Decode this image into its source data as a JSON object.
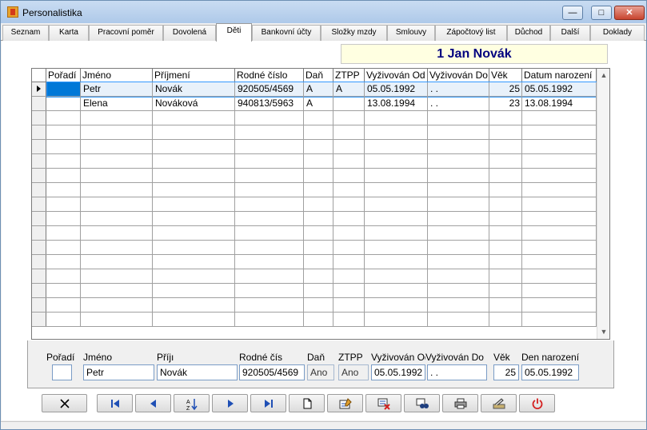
{
  "window": {
    "title": "Personalistika",
    "icon": "app-icon"
  },
  "tabs": [
    {
      "label": "Seznam"
    },
    {
      "label": "Karta"
    },
    {
      "label": "Pracovní poměr"
    },
    {
      "label": "Dovolená"
    },
    {
      "label": "Děti",
      "active": true
    },
    {
      "label": "Bankovní účty"
    },
    {
      "label": "Složky mzdy"
    },
    {
      "label": "Smlouvy"
    },
    {
      "label": "Zápočtový list"
    },
    {
      "label": "Důchod"
    },
    {
      "label": "Další"
    },
    {
      "label": "Doklady"
    }
  ],
  "banner": {
    "text": "1 Jan Novák",
    "color": "#00007f",
    "background": "#ffffe1"
  },
  "grid": {
    "columns": [
      "Pořadí",
      "Jméno",
      "Příjmení",
      "Rodné číslo",
      "Daň",
      "ZTPP",
      "Vyživován Od",
      "Vyživován Do",
      "Věk",
      "Datum narození"
    ],
    "rows": [
      {
        "poradi": "",
        "jmeno": "Petr",
        "prijmeni": "Novák",
        "rodne_cislo": "920505/4569",
        "dan": "A",
        "ztpp": "A",
        "od": "05.05.1992",
        "do": ". .",
        "vek": "25",
        "narozeni": "05.05.1992",
        "current": true
      },
      {
        "poradi": "",
        "jmeno": "Elena",
        "prijmeni": "Nováková",
        "rodne_cislo": "940813/5963",
        "dan": "A",
        "ztpp": "",
        "od": "13.08.1994",
        "do": ". .",
        "vek": "23",
        "narozeni": "13.08.1994",
        "current": false
      }
    ],
    "empty_rows": 15
  },
  "detail": {
    "labels": {
      "poradi": "Pořadí",
      "jmeno": "Jméno",
      "prijmeni": "Příjı",
      "rodne_cislo": "Rodné čís",
      "dan": "Daň",
      "ztpp": "ZTPP",
      "od": "Vyživován Od",
      "do": "Vyživován Do",
      "vek": "Věk",
      "narozeni": "Den narození"
    },
    "values": {
      "poradi": "",
      "jmeno": "Petr",
      "prijmeni": "Novák",
      "rodne_cislo": "920505/4569",
      "dan": "Ano",
      "ztpp": "Ano",
      "od": "05.05.1992",
      "do": ". .",
      "vek": "25",
      "narozeni": "05.05.1992"
    }
  },
  "toolbar": {
    "buttons": [
      {
        "name": "close-form-button",
        "icon": "x-icon"
      },
      {
        "name": "first-record-button",
        "icon": "first-icon"
      },
      {
        "name": "previous-record-button",
        "icon": "previous-icon"
      },
      {
        "name": "sort-button",
        "icon": "sort-az-icon"
      },
      {
        "name": "next-record-button",
        "icon": "next-icon"
      },
      {
        "name": "last-record-button",
        "icon": "last-icon"
      },
      {
        "name": "new-record-button",
        "icon": "new-document-icon"
      },
      {
        "name": "edit-record-button",
        "icon": "edit-icon"
      },
      {
        "name": "delete-record-button",
        "icon": "delete-icon"
      },
      {
        "name": "find-record-button",
        "icon": "binoculars-icon"
      },
      {
        "name": "print-button",
        "icon": "printer-icon"
      },
      {
        "name": "tools-button",
        "icon": "tools-icon"
      },
      {
        "name": "exit-button",
        "icon": "power-icon"
      }
    ]
  },
  "colors": {
    "accent": "#3399ff",
    "selection": "#0078d7",
    "nav_icons": "#1f4fb5",
    "exit_icon": "#d42020"
  }
}
